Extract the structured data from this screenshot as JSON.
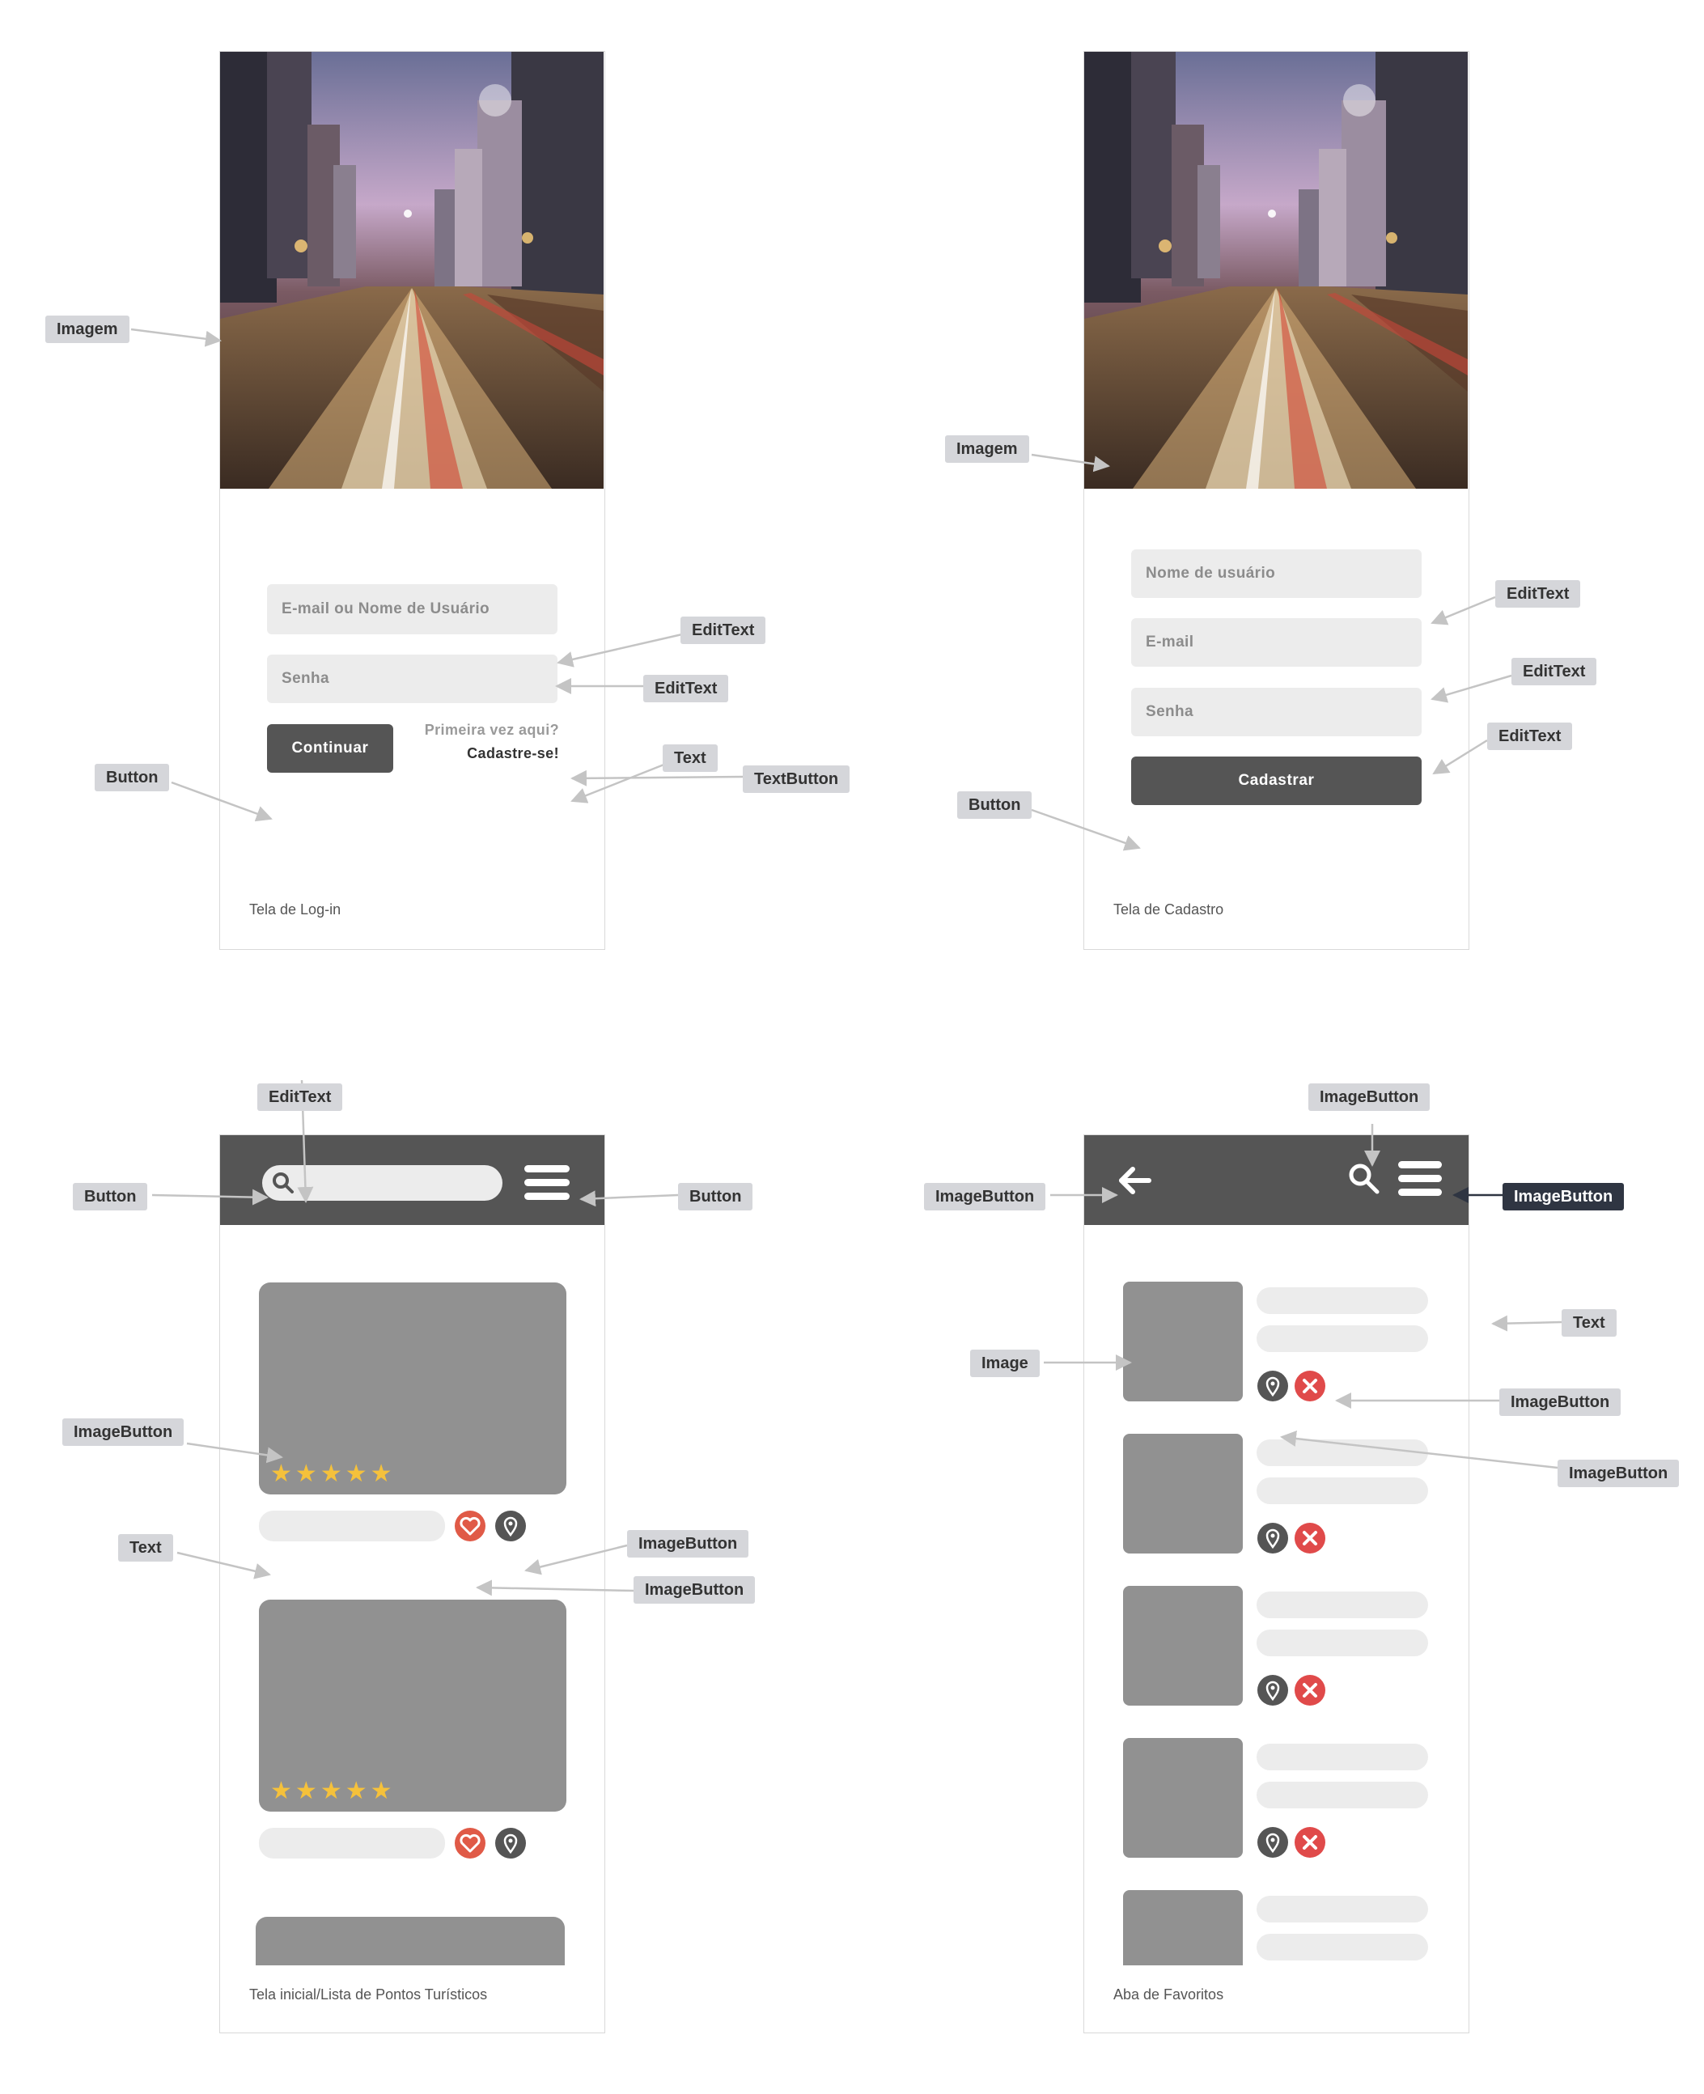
{
  "colors": {
    "frame_border": "#d9d9d9",
    "field": "#ececec",
    "dark": "#555555",
    "placeholder_gray": "#919191",
    "tag": "#d5d6da",
    "tag_selected": "#2f3542",
    "star": "#f5c13b",
    "heart": "#e05a47",
    "remove": "#e04a4a",
    "arrow": "#c4c4c4"
  },
  "screens": {
    "login": {
      "caption": "Tela de Log-in",
      "email_placeholder": "E-mail ou Nome de Usuário",
      "password_placeholder": "Senha",
      "continue_label": "Continuar",
      "first_time_text": "Primeira vez aqui?",
      "signup_link": "Cadastre-se!"
    },
    "signup": {
      "caption": "Tela de Cadastro",
      "username_placeholder": "Nome de usuário",
      "email_placeholder": "E-mail",
      "password_placeholder": "Senha",
      "register_label": "Cadastrar"
    },
    "home": {
      "caption": "Tela inicial/Lista de Pontos Turísticos",
      "rating_stars": 5,
      "icons": [
        "search-icon",
        "menu-icon",
        "heart-icon",
        "location-pin-icon",
        "star-icon"
      ]
    },
    "favorites": {
      "caption": "Aba de Favoritos",
      "icons": [
        "back-arrow-icon",
        "search-icon",
        "menu-icon",
        "location-pin-icon",
        "remove-icon"
      ]
    }
  },
  "annotations": {
    "login_image": "Imagem",
    "login_edittext_1": "EditText",
    "login_edittext_2": "EditText",
    "login_button": "Button",
    "login_text": "Text",
    "login_textbutton": "TextButton",
    "signup_image": "Imagem",
    "signup_edittext_1": "EditText",
    "signup_edittext_2": "EditText",
    "signup_edittext_3": "EditText",
    "signup_button": "Button",
    "home_edittext": "EditText",
    "home_button_left": "Button",
    "home_button_right": "Button",
    "home_imagebutton_card": "ImageButton",
    "home_text": "Text",
    "home_imagebutton_1": "ImageButton",
    "home_imagebutton_2": "ImageButton",
    "fav_imagebutton_top": "ImageButton",
    "fav_imagebutton_left": "ImageButton",
    "fav_imagebutton_right": "ImageButton",
    "fav_text": "Text",
    "fav_image": "Image",
    "fav_imagebutton_mid": "ImageButton",
    "fav_imagebutton_low": "ImageButton"
  }
}
